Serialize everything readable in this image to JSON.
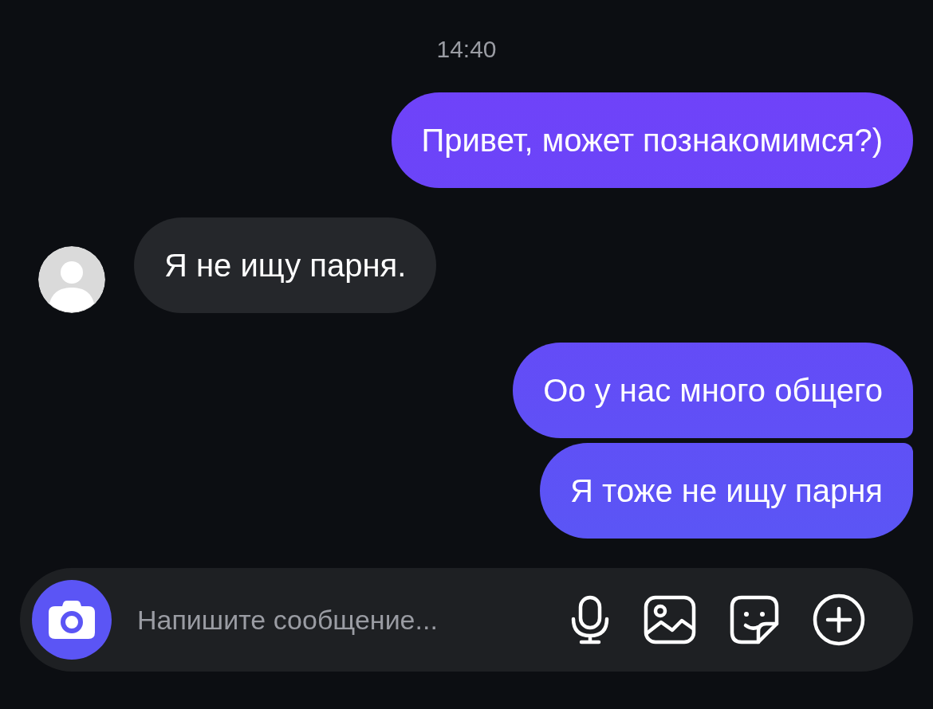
{
  "timestamp": "14:40",
  "messages": [
    {
      "kind": "outgoing",
      "text": "Привет, может познакомимся?)"
    },
    {
      "kind": "incoming",
      "text": "Я не ищу парня."
    },
    {
      "kind": "outgoing",
      "text": "Оо у нас много общего"
    },
    {
      "kind": "outgoing",
      "text": "Я тоже не ищу парня"
    }
  ],
  "composer": {
    "placeholder": "Напишите сообщение..."
  }
}
